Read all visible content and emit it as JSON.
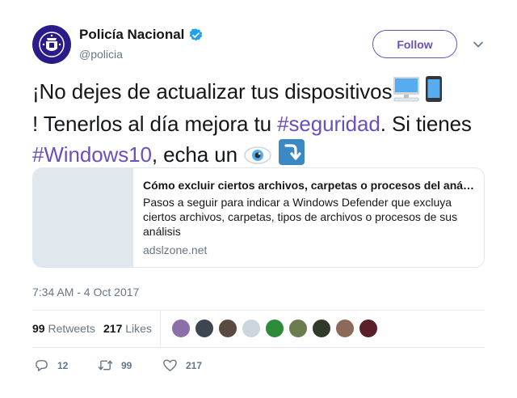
{
  "author": {
    "display_name": "Policía Nacional",
    "handle": "@policia",
    "verified": true,
    "avatar_icon": "police-badge-icon",
    "avatar_color": "#2b1a8a"
  },
  "follow_label": "Follow",
  "tweet": {
    "text_1": "¡No dejes de actualizar tus dispositivos",
    "text_2": "! Tenerlos al día mejora tu ",
    "hashtag_1": "#seguridad",
    "text_3": ". Si tienes ",
    "hashtag_2": "#Windows10",
    "text_4": ", echa un ",
    "emojis": [
      "computer-emoji",
      "mobile-phone-emoji",
      "eye-emoji",
      "right-arrow-curving-down-emoji"
    ]
  },
  "card": {
    "title": "Cómo excluir ciertos archivos, carpetas o procesos del análisis de Windows Defender",
    "description": "Pasos a seguir para indicar a Windows Defender que excluya ciertos archivos, carpetas, tipos de archivos o procesos de sus análisis",
    "domain": "adslzone.net"
  },
  "timestamp": "7:34 AM - 4 Oct 2017",
  "stats": {
    "retweets_count": "99",
    "retweets_label": "Retweets",
    "likes_count": "217",
    "likes_label": "Likes"
  },
  "actions": {
    "reply_count": "12",
    "retweet_count": "99",
    "like_count": "217"
  },
  "colors": {
    "accent": "#6b4fbb",
    "verified": "#1da1f2",
    "muted": "#657786"
  }
}
